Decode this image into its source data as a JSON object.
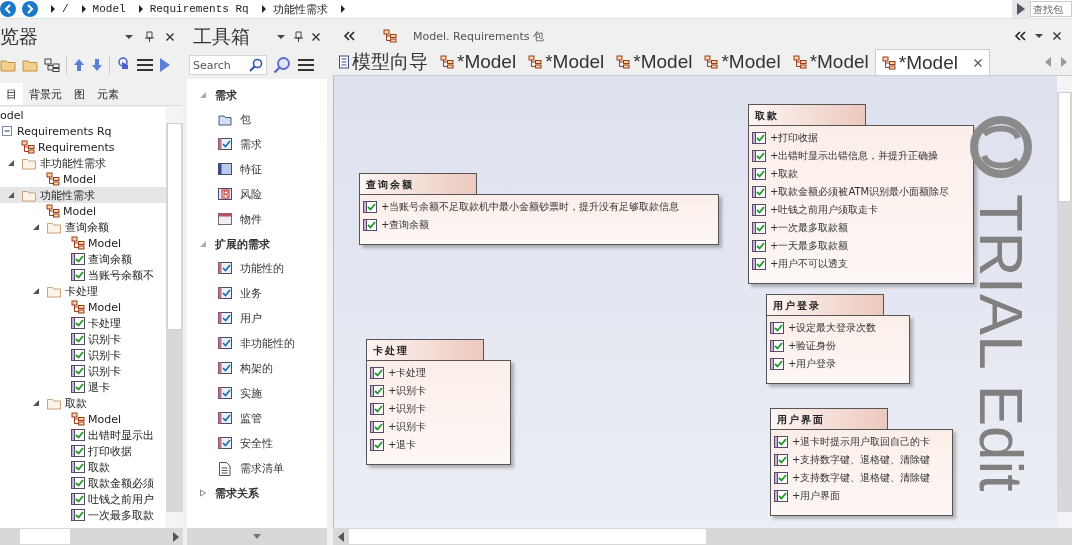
{
  "breadcrumb": {
    "items": [
      "/",
      "Model",
      "Requirements Rq",
      "功能性需求"
    ],
    "search": {
      "placeholder": "查找包"
    }
  },
  "browser": {
    "title": "览器",
    "tabs": [
      {
        "label": "目",
        "selected": true
      },
      {
        "label": "背景元",
        "selected": false
      },
      {
        "label": "图",
        "selected": false
      },
      {
        "label": "元素",
        "selected": false
      }
    ],
    "tree": [
      {
        "label": "odel",
        "kind": "root",
        "selected": false,
        "children": [
          {
            "label": "Requirements Rq",
            "kind": "model",
            "selected": false,
            "expanded": true,
            "children": [
              {
                "label": "Requirements",
                "kind": "diagram",
                "selected": false
              },
              {
                "label": "非功能性需求",
                "kind": "package",
                "selected": false,
                "expanded": true,
                "children": [
                  {
                    "label": "Model",
                    "kind": "diagram",
                    "selected": false
                  }
                ]
              },
              {
                "label": "功能性需求",
                "kind": "package",
                "selected": true,
                "expanded": true,
                "children": [
                  {
                    "label": "Model",
                    "kind": "diagram",
                    "selected": false
                  },
                  {
                    "label": "查询余额",
                    "kind": "package",
                    "selected": false,
                    "expanded": true,
                    "children": [
                      {
                        "label": "Model",
                        "kind": "diagram",
                        "selected": false
                      },
                      {
                        "label": "查询余额",
                        "kind": "requirement",
                        "selected": false
                      },
                      {
                        "label": "当账号余额不",
                        "kind": "requirement",
                        "selected": false
                      }
                    ]
                  },
                  {
                    "label": "卡处理",
                    "kind": "package",
                    "selected": false,
                    "expanded": true,
                    "children": [
                      {
                        "label": "Model",
                        "kind": "diagram",
                        "selected": false
                      },
                      {
                        "label": "卡处理",
                        "kind": "requirement",
                        "selected": false
                      },
                      {
                        "label": "识别卡",
                        "kind": "requirement",
                        "selected": false
                      },
                      {
                        "label": "识别卡",
                        "kind": "requirement",
                        "selected": false
                      },
                      {
                        "label": "识别卡",
                        "kind": "requirement",
                        "selected": false
                      },
                      {
                        "label": "退卡",
                        "kind": "requirement",
                        "selected": false
                      }
                    ]
                  },
                  {
                    "label": "取款",
                    "kind": "package",
                    "selected": false,
                    "expanded": true,
                    "children": [
                      {
                        "label": "Model",
                        "kind": "diagram",
                        "selected": false
                      },
                      {
                        "label": "出错时显示出",
                        "kind": "requirement",
                        "selected": false
                      },
                      {
                        "label": "打印收据",
                        "kind": "requirement",
                        "selected": false
                      },
                      {
                        "label": "取款",
                        "kind": "requirement",
                        "selected": false
                      },
                      {
                        "label": "取款金额必须",
                        "kind": "requirement",
                        "selected": false
                      },
                      {
                        "label": "吐钱之前用户",
                        "kind": "requirement",
                        "selected": false
                      },
                      {
                        "label": "一次最多取款",
                        "kind": "requirement",
                        "selected": false
                      }
                    ]
                  }
                ]
              }
            ]
          }
        ]
      }
    ]
  },
  "toolbox": {
    "title": "工具箱",
    "search": {
      "placeholder": "Search"
    },
    "sections": [
      {
        "label": "需求",
        "expanded": true,
        "items": [
          {
            "label": "包",
            "kind": "package"
          },
          {
            "label": "需求",
            "kind": "requirement"
          },
          {
            "label": "特征",
            "kind": "feature"
          },
          {
            "label": "风险",
            "kind": "risk"
          },
          {
            "label": "物件",
            "kind": "artifact"
          }
        ]
      },
      {
        "label": "扩展的需求",
        "expanded": true,
        "items": [
          {
            "label": "功能性的",
            "kind": "requirement"
          },
          {
            "label": "业务",
            "kind": "requirement"
          },
          {
            "label": "用户",
            "kind": "requirement"
          },
          {
            "label": "非功能性的",
            "kind": "requirement"
          },
          {
            "label": "构架的",
            "kind": "requirement"
          },
          {
            "label": "实施",
            "kind": "requirement"
          },
          {
            "label": "监管",
            "kind": "requirement"
          },
          {
            "label": "安全性",
            "kind": "requirement"
          },
          {
            "label": "需求清单",
            "kind": "list"
          }
        ]
      },
      {
        "label": "需求关系",
        "expanded": false
      }
    ]
  },
  "editor": {
    "path": "Model. Requirements 包",
    "tabs": [
      {
        "label": "模型向导",
        "kind": "wizard",
        "selected": false
      },
      {
        "label": "*Model",
        "kind": "diagram",
        "selected": false
      },
      {
        "label": "*Model",
        "kind": "diagram",
        "selected": false
      },
      {
        "label": "*Model",
        "kind": "diagram",
        "selected": false
      },
      {
        "label": "*Model",
        "kind": "diagram",
        "selected": false
      },
      {
        "label": "*Model",
        "kind": "diagram",
        "selected": false
      },
      {
        "label": "*Model",
        "kind": "diagram",
        "selected": true
      }
    ],
    "diagram": {
      "packages": [
        {
          "name": "查询余额",
          "items": [
            "+当账号余额不足取款机中最小金额钞票时，提升没有足够取款信息",
            "+查询余额"
          ]
        },
        {
          "name": "取款",
          "items": [
            "+打印收据",
            "+出错时显示出错信息，并提升正确操",
            "+取款",
            "+取款金额必须被ATM识别最小面额除尽",
            "+吐钱之前用户须取走卡",
            "+一次最多取款额",
            "+一天最多取款额",
            "+用户不可以透支"
          ]
        },
        {
          "name": "用户登录",
          "items": [
            "+设定最大登录次数",
            "+验证身份",
            "+用户登录"
          ]
        },
        {
          "name": "卡处理",
          "items": [
            "+卡处理",
            "+识别卡",
            "+识别卡",
            "+识别卡",
            "+退卡"
          ]
        },
        {
          "name": "用户界面",
          "items": [
            "+退卡时提示用户取回自己的卡",
            "+支持数字键、退格键、清除键",
            "+支持数字键、退格键、清除键",
            "+用户界面"
          ]
        }
      ],
      "watermark": "TRIAL Edit"
    }
  }
}
